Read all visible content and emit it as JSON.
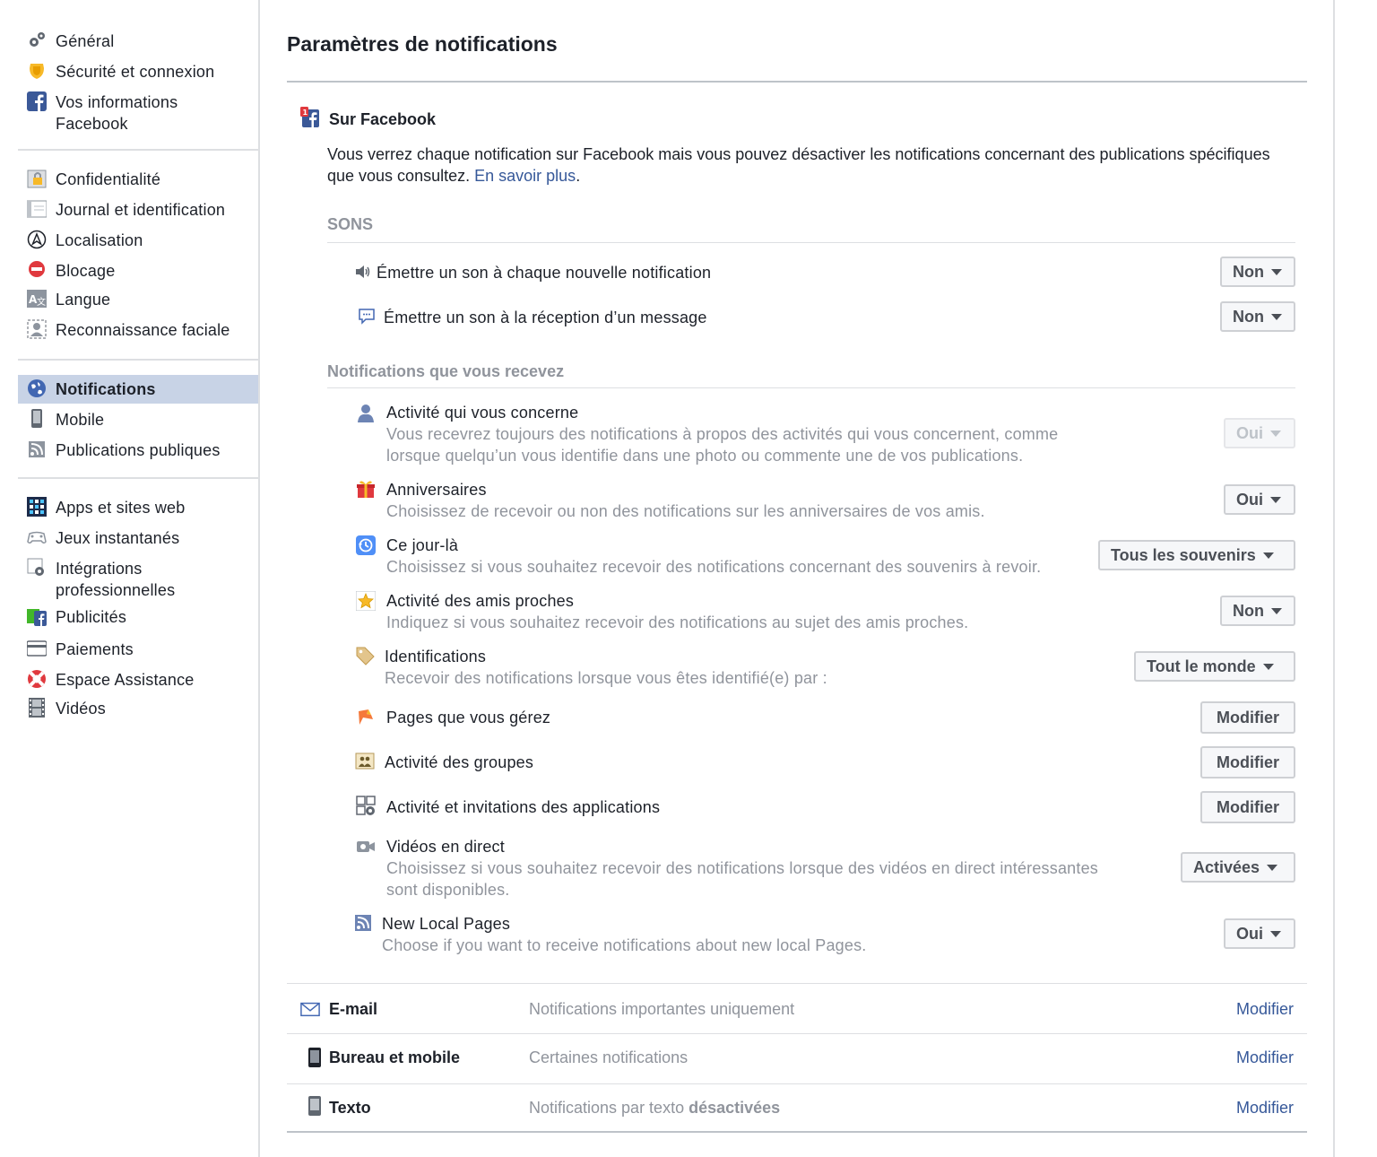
{
  "sidebar": {
    "group1": [
      {
        "label": "Général",
        "icon": "gears-icon"
      },
      {
        "label": "Sécurité et connexion",
        "icon": "badge-icon"
      },
      {
        "label": "Vos informations",
        "label2": "Facebook",
        "icon": "facebook-icon"
      }
    ],
    "group2": [
      {
        "label": "Confidentialité",
        "icon": "lock-icon"
      },
      {
        "label": "Journal et identification",
        "icon": "timeline-icon"
      },
      {
        "label": "Localisation",
        "icon": "location-icon"
      },
      {
        "label": "Blocage",
        "icon": "block-icon"
      },
      {
        "label": "Langue",
        "icon": "language-icon"
      },
      {
        "label": "Reconnaissance faciale",
        "icon": "face-icon"
      }
    ],
    "group3": [
      {
        "label": "Notifications",
        "icon": "globe-icon"
      },
      {
        "label": "Mobile",
        "icon": "mobile-icon"
      },
      {
        "label": "Publications publiques",
        "icon": "rss-icon"
      }
    ],
    "group4": [
      {
        "label": "Apps et sites web",
        "icon": "apps-icon"
      },
      {
        "label": "Jeux instantanés",
        "icon": "gamepad-icon"
      },
      {
        "label": "Intégrations",
        "label2": "professionnelles",
        "icon": "integrations-icon"
      },
      {
        "label": "Publicités",
        "icon": "ads-icon"
      },
      {
        "label": "Paiements",
        "icon": "card-icon"
      },
      {
        "label": "Espace Assistance",
        "icon": "lifebuoy-icon"
      },
      {
        "label": "Vidéos",
        "icon": "film-icon"
      }
    ]
  },
  "main": {
    "title": "Paramètres de notifications",
    "on_facebook": {
      "header": "Sur Facebook",
      "description": "Vous verrez chaque notification sur Facebook mais vous pouvez désactiver les notifications concernant des publications spécifiques que vous consultez.",
      "learn_more": "En savoir plus",
      "period": "."
    },
    "sounds": {
      "header": "SONS",
      "rows": [
        {
          "label": "Émettre un son à chaque nouvelle notification",
          "value": "Non",
          "icon": "speaker-icon"
        },
        {
          "label": "Émettre un son à la réception d’un message",
          "value": "Non",
          "icon": "chat-icon"
        }
      ]
    },
    "received": {
      "header": "Notifications que vous recevez",
      "rows": [
        {
          "title": "Activité qui vous concerne",
          "sub1": "Vous recevrez toujours des notifications à propos des activités qui vous concernent, comme",
          "sub2": "lorsque quelqu’un vous identifie dans une photo ou commente une de vos publications.",
          "value": "Oui",
          "icon": "person-icon"
        },
        {
          "title": "Anniversaires",
          "sub1": "Choisissez de recevoir ou non des notifications sur les anniversaires de vos amis.",
          "value": "Oui",
          "icon": "gift-icon"
        },
        {
          "title": "Ce jour-là",
          "sub1": "Choisissez si vous souhaitez recevoir des notifications concernant des souvenirs à revoir.",
          "value": "Tous les souvenirs",
          "icon": "history-icon"
        },
        {
          "title": "Activité des amis proches",
          "sub1": "Indiquez si vous souhaitez recevoir des notifications au sujet des amis proches.",
          "value": "Non",
          "icon": "star-icon"
        },
        {
          "title": "Identifications",
          "sub1": "Recevoir des notifications lorsque vous êtes identifié(e) par :",
          "value": "Tout le monde",
          "icon": "tag-icon"
        },
        {
          "title": "Pages que vous gérez",
          "action": "Modifier",
          "icon": "flag-icon"
        },
        {
          "title": "Activité des groupes",
          "action": "Modifier",
          "icon": "group-icon"
        },
        {
          "title": "Activité et invitations des applications",
          "action": "Modifier",
          "icon": "app-invite-icon"
        },
        {
          "title": "Vidéos en direct",
          "sub1": "Choisissez si vous souhaitez recevoir des notifications lorsque des vidéos en direct intéressantes",
          "sub2": "sont disponibles.",
          "value": "Activées",
          "icon": "video-camera-icon"
        },
        {
          "title": "New Local Pages",
          "sub1": "Choose if you want to receive notifications about new local Pages.",
          "value": "Oui",
          "icon": "rss-icon"
        }
      ]
    },
    "channels": [
      {
        "label": "E-mail",
        "desc": "Notifications importantes uniquement",
        "link": "Modifier",
        "icon": "envelope-icon"
      },
      {
        "label": "Bureau et mobile",
        "desc": "Certaines notifications",
        "link": "Modifier",
        "icon": "phone-icon"
      },
      {
        "label": "Texto",
        "desc_prefix": "Notifications par texto ",
        "desc_bold": "désactivées",
        "link": "Modifier",
        "icon": "sms-icon"
      }
    ]
  }
}
